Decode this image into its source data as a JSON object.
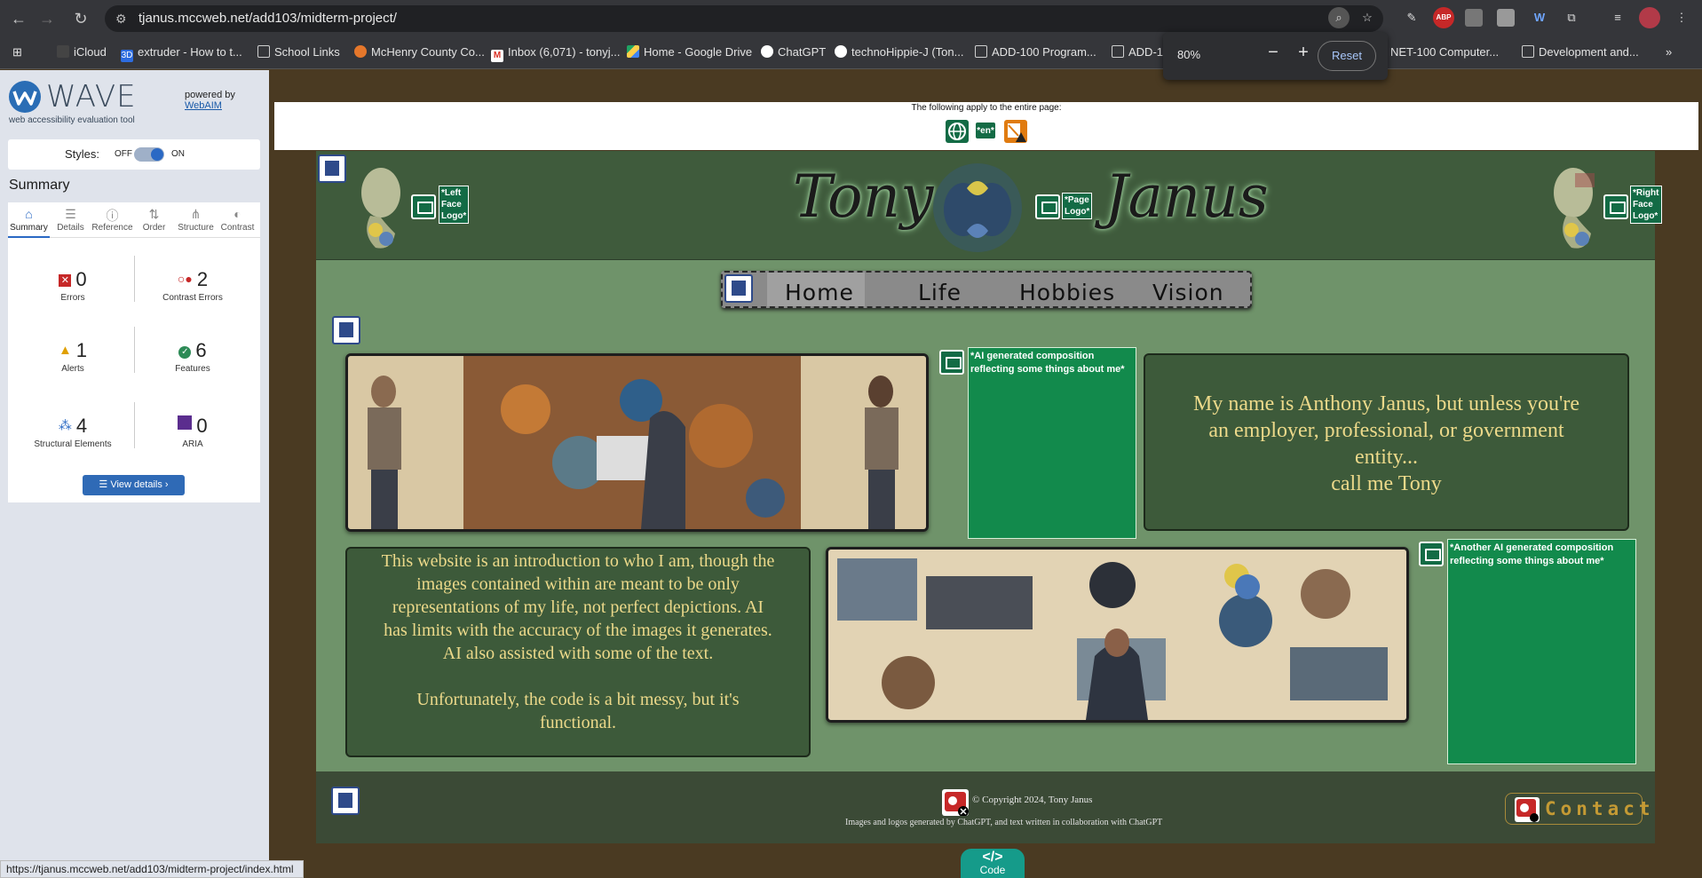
{
  "browser": {
    "url": "tjanus.mccweb.net/add103/midterm-project/",
    "status_url": "https://tjanus.mccweb.net/add103/midterm-project/index.html",
    "zoom_value": "80%",
    "zoom_minus": "−",
    "zoom_plus": "+",
    "zoom_reset": "Reset",
    "bookmarks": [
      "iCloud",
      "extruder - How to t...",
      "School Links",
      "McHenry County Co...",
      "Inbox (6,071) - tonyj...",
      "Home - Google Drive",
      "ChatGPT",
      "technoHippie-J (Ton...",
      "ADD-100 Program...",
      "ADD-1",
      "NET-100 Computer...",
      "Development and..."
    ]
  },
  "wave": {
    "title": "WAVE",
    "subtitle": "web accessibility evaluation tool",
    "powered_by": "powered by",
    "webaim": "WebAIM",
    "styles_label": "Styles:",
    "styles_off": "OFF",
    "styles_on": "ON",
    "summary_title": "Summary",
    "tabs": [
      "Summary",
      "Details",
      "Reference",
      "Order",
      "Structure",
      "Contrast"
    ],
    "stats": {
      "errors": {
        "value": "0",
        "label": "Errors"
      },
      "contrast": {
        "value": "2",
        "label": "Contrast Errors"
      },
      "alerts": {
        "value": "1",
        "label": "Alerts"
      },
      "features": {
        "value": "6",
        "label": "Features"
      },
      "structural": {
        "value": "4",
        "label": "Structural Elements"
      },
      "aria": {
        "value": "0",
        "label": "ARIA"
      }
    },
    "view_details": "View details ›",
    "colors": {
      "accent": "#2a69c4",
      "error": "#c62828",
      "alert": "#e0a000",
      "feature": "#2e8b57",
      "aria": "#5b2d8e"
    }
  },
  "page": {
    "applies_text": "The following apply to the entire page:",
    "lang_badge": "*en*",
    "header": {
      "first_name": "Tony",
      "last_name": "Janus",
      "left_alt": "*Left Face Logo*",
      "page_alt": "*Page Logo*",
      "right_alt": "*Right Face Logo*"
    },
    "nav": [
      "Home",
      "Life",
      "Hobbies",
      "Vision"
    ],
    "img1_alt": "*AI generated composition reflecting some things about me*",
    "img2_alt": "*Another AI generated composition reflecting some things about me*",
    "intro_text": "My name is Anthony Janus, but unless you're an employer, professional, or government entity...",
    "intro_call": "call me Tony",
    "about_text": "This website is an introduction to who I am, though the images contained within are meant to be only representations of my life, not perfect depictions. AI has limits with the accuracy of the images it generates. AI also assisted with some of the text.",
    "about_text2": "Unfortunately, the code is a bit messy, but it's functional.",
    "copyright": "© Copyright 2024, Tony Janus",
    "credit": "Images and logos generated by ChatGPT, and text written in collaboration with ChatGPT",
    "contact": "Contact",
    "code_label": "Code",
    "code_icon": "</>"
  }
}
